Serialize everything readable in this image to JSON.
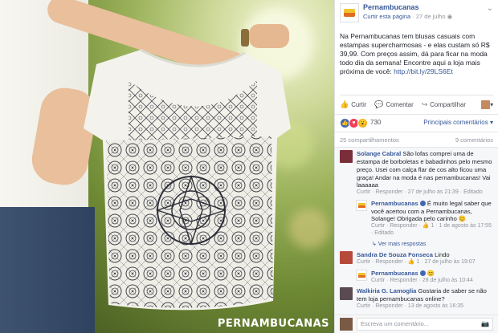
{
  "page": {
    "name": "Pernambucanas",
    "like_page": "Curtir esta página",
    "separator": " · ",
    "date": "27 de julho",
    "globe": "·"
  },
  "post": {
    "text": "Na Pernambucanas tem blusas casuais com estampas supercharmosas - e elas custam só R$ 39,99. Com preços assim, dá para ficar na moda todo dia da semana! Encontre aqui a loja mais próxima de você: ",
    "link": "http://bit.ly/29LS6Et"
  },
  "actions": {
    "like": "Curtir",
    "comment": "Comentar",
    "share": "Compartilhar"
  },
  "reactions": {
    "count": "730",
    "top_comments": "Principais comentários ▾"
  },
  "stats": {
    "shares": "25 compartilhamentos",
    "comments": "9 comentários"
  },
  "photo": {
    "watermark": "PERNAMBUCANAS"
  },
  "comments": [
    {
      "author": "Solange Cabral",
      "text": "São lofas comprei uma de estampa de borboletas e babadinhos pelo mesmo preço. Usei com calça flar de cos alto ficou uma graça! Andar na moda é nas pernambucanas! Vai laaaaaa",
      "meta": "Curtir · Responder · 27 de julho às 21:39 · Editado"
    },
    {
      "author": "Pernambucanas",
      "reply": true,
      "text": "É muito legal saber que você acertou com a Pernambucanas, Solange! Obrigada pelo carinho 😊",
      "meta": "Curtir · Responder · 👍 1 · 1 de agosto às 17:55 · Editado"
    },
    {
      "see_more": "↳ Ver mais respostas"
    },
    {
      "author": "Sandra De Souza Fonseca",
      "text": " Lindo",
      "meta": "Curtir · Responder · 👍 1 · 27 de julho às 19:07"
    },
    {
      "author": "Pernambucanas",
      "reply": true,
      "text": " 😊",
      "meta": "Curtir · Responder · 28 de julho às 10:44"
    },
    {
      "author": "Walkiria G. Lamoglia",
      "text": " Gostaria de saber se não tem loja pernambucanas online?",
      "meta": "Curtir · Responder · 13 de agosto às 16:35"
    }
  ],
  "write_comment": {
    "placeholder": "Escreva um comentário..."
  },
  "colors": {
    "link": "#365899",
    "muted": "#90949c",
    "like_blue": "#4267b2"
  }
}
